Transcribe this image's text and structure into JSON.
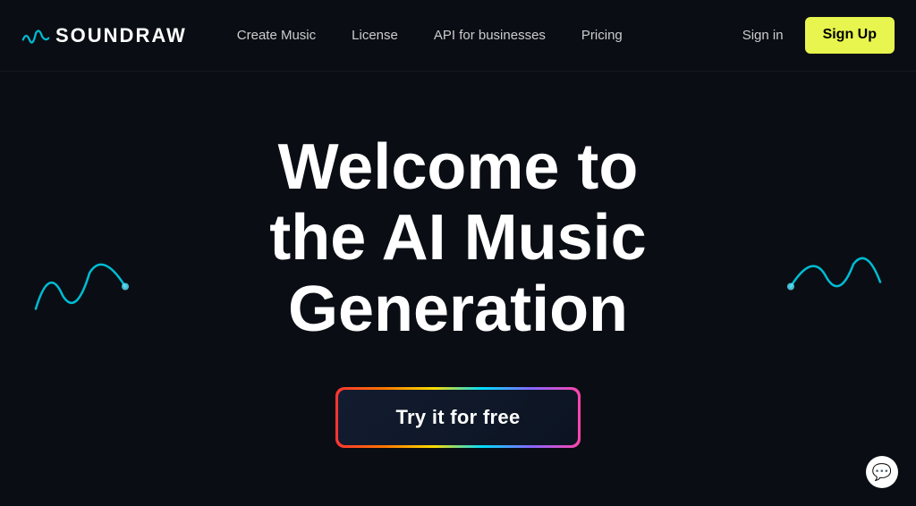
{
  "logo": {
    "text": "SOUNDRAW",
    "icon_name": "soundwave-logo-icon"
  },
  "nav": {
    "links": [
      {
        "label": "Create Music",
        "id": "create-music"
      },
      {
        "label": "License",
        "id": "license"
      },
      {
        "label": "API for businesses",
        "id": "api-for-businesses"
      },
      {
        "label": "Pricing",
        "id": "pricing"
      }
    ],
    "sign_in_label": "Sign in",
    "sign_up_label": "Sign Up"
  },
  "hero": {
    "title_line1": "Welcome to",
    "title_line2": "the AI Music",
    "title_line3": "Generation",
    "cta_label": "Try it for free"
  },
  "chat": {
    "icon": "💬"
  }
}
